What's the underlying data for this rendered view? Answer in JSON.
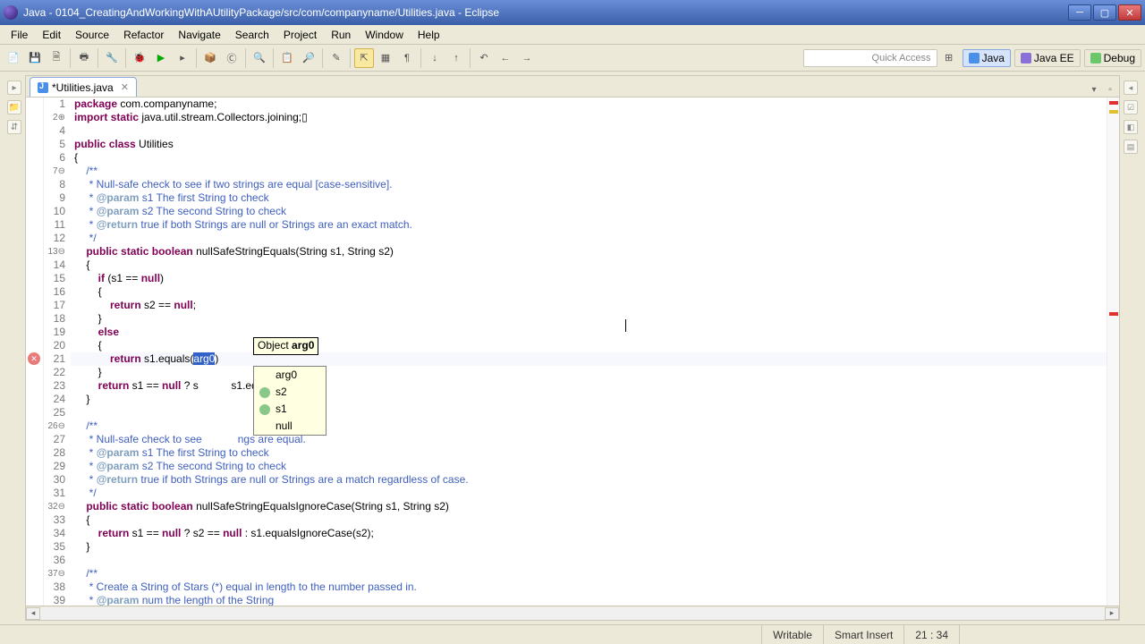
{
  "title": "Java - 0104_CreatingAndWorkingWithAUtilityPackage/src/com/companyname/Utilities.java - Eclipse",
  "menu": [
    "File",
    "Edit",
    "Source",
    "Refactor",
    "Navigate",
    "Search",
    "Project",
    "Run",
    "Window",
    "Help"
  ],
  "quick_access_placeholder": "Quick Access",
  "perspectives": {
    "java": "Java",
    "javaee": "Java EE",
    "debug": "Debug"
  },
  "tab": {
    "name": "*Utilities.java"
  },
  "param_hint_prefix": "Object ",
  "param_hint_bold": "arg0",
  "autocomplete": [
    "arg0",
    "s2",
    "s1",
    "null"
  ],
  "status": {
    "writable": "Writable",
    "insert": "Smart Insert",
    "pos": "21 : 34"
  },
  "error_line": 21,
  "code_lines": [
    {
      "n": 1,
      "seg": [
        {
          "c": "kw",
          "t": "package"
        },
        {
          "t": " com.companyname;"
        }
      ]
    },
    {
      "n": 2,
      "fold": "⊕",
      "seg": [
        {
          "c": "kw",
          "t": "import"
        },
        {
          "t": " "
        },
        {
          "c": "kw",
          "t": "static"
        },
        {
          "t": " java.util.stream.Collectors."
        },
        {
          "c": "",
          "t": "joining"
        },
        {
          "t": ";"
        },
        {
          "c": "",
          "t": "▯"
        }
      ]
    },
    {
      "n": 4,
      "seg": []
    },
    {
      "n": 5,
      "seg": [
        {
          "c": "kw",
          "t": "public"
        },
        {
          "t": " "
        },
        {
          "c": "kw",
          "t": "class"
        },
        {
          "t": " Utilities"
        }
      ]
    },
    {
      "n": 6,
      "seg": [
        {
          "t": "{"
        }
      ]
    },
    {
      "n": 7,
      "fold": "⊖",
      "seg": [
        {
          "t": "    "
        },
        {
          "c": "jd",
          "t": "/**"
        }
      ]
    },
    {
      "n": 8,
      "seg": [
        {
          "t": "     "
        },
        {
          "c": "jd",
          "t": "* Null-safe check to see if two strings are equal [case-sensitive]."
        }
      ]
    },
    {
      "n": 9,
      "seg": [
        {
          "t": "     "
        },
        {
          "c": "jd",
          "t": "* "
        },
        {
          "c": "jdt",
          "t": "@param"
        },
        {
          "c": "jd",
          "t": " s1 The first String to check"
        }
      ]
    },
    {
      "n": 10,
      "seg": [
        {
          "t": "     "
        },
        {
          "c": "jd",
          "t": "* "
        },
        {
          "c": "jdt",
          "t": "@param"
        },
        {
          "c": "jd",
          "t": " s2 The second String to check"
        }
      ]
    },
    {
      "n": 11,
      "seg": [
        {
          "t": "     "
        },
        {
          "c": "jd",
          "t": "* "
        },
        {
          "c": "jdt",
          "t": "@return"
        },
        {
          "c": "jd",
          "t": " true if both Strings are null or Strings are an exact match."
        }
      ]
    },
    {
      "n": 12,
      "seg": [
        {
          "t": "     "
        },
        {
          "c": "jd",
          "t": "*/"
        }
      ]
    },
    {
      "n": 13,
      "fold": "⊖",
      "seg": [
        {
          "t": "    "
        },
        {
          "c": "kw",
          "t": "public"
        },
        {
          "t": " "
        },
        {
          "c": "kw",
          "t": "static"
        },
        {
          "t": " "
        },
        {
          "c": "kw",
          "t": "boolean"
        },
        {
          "t": " nullSafeStringEquals(String s1, String s2)"
        }
      ]
    },
    {
      "n": 14,
      "seg": [
        {
          "t": "    {"
        }
      ]
    },
    {
      "n": 15,
      "seg": [
        {
          "t": "        "
        },
        {
          "c": "kw",
          "t": "if"
        },
        {
          "t": " (s1 == "
        },
        {
          "c": "kw",
          "t": "null"
        },
        {
          "t": ")"
        }
      ]
    },
    {
      "n": 16,
      "seg": [
        {
          "t": "        {"
        }
      ]
    },
    {
      "n": 17,
      "seg": [
        {
          "t": "            "
        },
        {
          "c": "kw",
          "t": "return"
        },
        {
          "t": " s2 == "
        },
        {
          "c": "kw",
          "t": "null"
        },
        {
          "t": ";"
        }
      ]
    },
    {
      "n": 18,
      "seg": [
        {
          "t": "        }"
        }
      ]
    },
    {
      "n": 19,
      "seg": [
        {
          "t": "        "
        },
        {
          "c": "kw",
          "t": "else"
        }
      ]
    },
    {
      "n": 20,
      "seg": [
        {
          "t": "        {"
        }
      ]
    },
    {
      "n": 21,
      "hl": true,
      "seg": [
        {
          "t": "            "
        },
        {
          "c": "kw",
          "t": "return"
        },
        {
          "t": " s1.equals("
        },
        {
          "c": "selparam",
          "t": "arg0"
        },
        {
          "t": ")"
        }
      ]
    },
    {
      "n": 22,
      "seg": [
        {
          "t": "        }"
        }
      ]
    },
    {
      "n": 23,
      "seg": [
        {
          "t": "        "
        },
        {
          "c": "kw",
          "t": "return"
        },
        {
          "t": " s1 == "
        },
        {
          "c": "kw",
          "t": "null"
        },
        {
          "t": " ? s"
        },
        {
          "t": "           "
        },
        {
          "t": "s1.equals(s2);"
        }
      ]
    },
    {
      "n": 24,
      "seg": [
        {
          "t": "    }"
        }
      ]
    },
    {
      "n": 25,
      "seg": []
    },
    {
      "n": 26,
      "fold": "⊖",
      "seg": [
        {
          "t": "    "
        },
        {
          "c": "jd",
          "t": "/**"
        }
      ]
    },
    {
      "n": 27,
      "seg": [
        {
          "t": "     "
        },
        {
          "c": "jd",
          "t": "* Null-safe check to see            ngs are equal."
        }
      ]
    },
    {
      "n": 28,
      "seg": [
        {
          "t": "     "
        },
        {
          "c": "jd",
          "t": "* "
        },
        {
          "c": "jdt",
          "t": "@param"
        },
        {
          "c": "jd",
          "t": " s1 The first String to check"
        }
      ]
    },
    {
      "n": 29,
      "seg": [
        {
          "t": "     "
        },
        {
          "c": "jd",
          "t": "* "
        },
        {
          "c": "jdt",
          "t": "@param"
        },
        {
          "c": "jd",
          "t": " s2 The second String to check"
        }
      ]
    },
    {
      "n": 30,
      "seg": [
        {
          "t": "     "
        },
        {
          "c": "jd",
          "t": "* "
        },
        {
          "c": "jdt",
          "t": "@return"
        },
        {
          "c": "jd",
          "t": " true if both Strings are null or Strings are a match regardless of case."
        }
      ]
    },
    {
      "n": 31,
      "seg": [
        {
          "t": "     "
        },
        {
          "c": "jd",
          "t": "*/"
        }
      ]
    },
    {
      "n": 32,
      "fold": "⊖",
      "seg": [
        {
          "t": "    "
        },
        {
          "c": "kw",
          "t": "public"
        },
        {
          "t": " "
        },
        {
          "c": "kw",
          "t": "static"
        },
        {
          "t": " "
        },
        {
          "c": "kw",
          "t": "boolean"
        },
        {
          "t": " nullSafeStringEqualsIgnoreCase(String s1, String s2)"
        }
      ]
    },
    {
      "n": 33,
      "seg": [
        {
          "t": "    {"
        }
      ]
    },
    {
      "n": 34,
      "seg": [
        {
          "t": "        "
        },
        {
          "c": "kw",
          "t": "return"
        },
        {
          "t": " s1 == "
        },
        {
          "c": "kw",
          "t": "null"
        },
        {
          "t": " ? s2 == "
        },
        {
          "c": "kw",
          "t": "null"
        },
        {
          "t": " : s1.equalsIgnoreCase(s2);"
        }
      ]
    },
    {
      "n": 35,
      "seg": [
        {
          "t": "    }"
        }
      ]
    },
    {
      "n": 36,
      "seg": []
    },
    {
      "n": 37,
      "fold": "⊖",
      "seg": [
        {
          "t": "    "
        },
        {
          "c": "jd",
          "t": "/**"
        }
      ]
    },
    {
      "n": 38,
      "seg": [
        {
          "t": "     "
        },
        {
          "c": "jd",
          "t": "* Create a String of Stars (*) equal in length to the number passed in."
        }
      ]
    },
    {
      "n": 39,
      "seg": [
        {
          "t": "     "
        },
        {
          "c": "jd",
          "t": "* "
        },
        {
          "c": "jdt",
          "t": "@param"
        },
        {
          "c": "jd",
          "t": " num the length of the String"
        }
      ]
    }
  ]
}
